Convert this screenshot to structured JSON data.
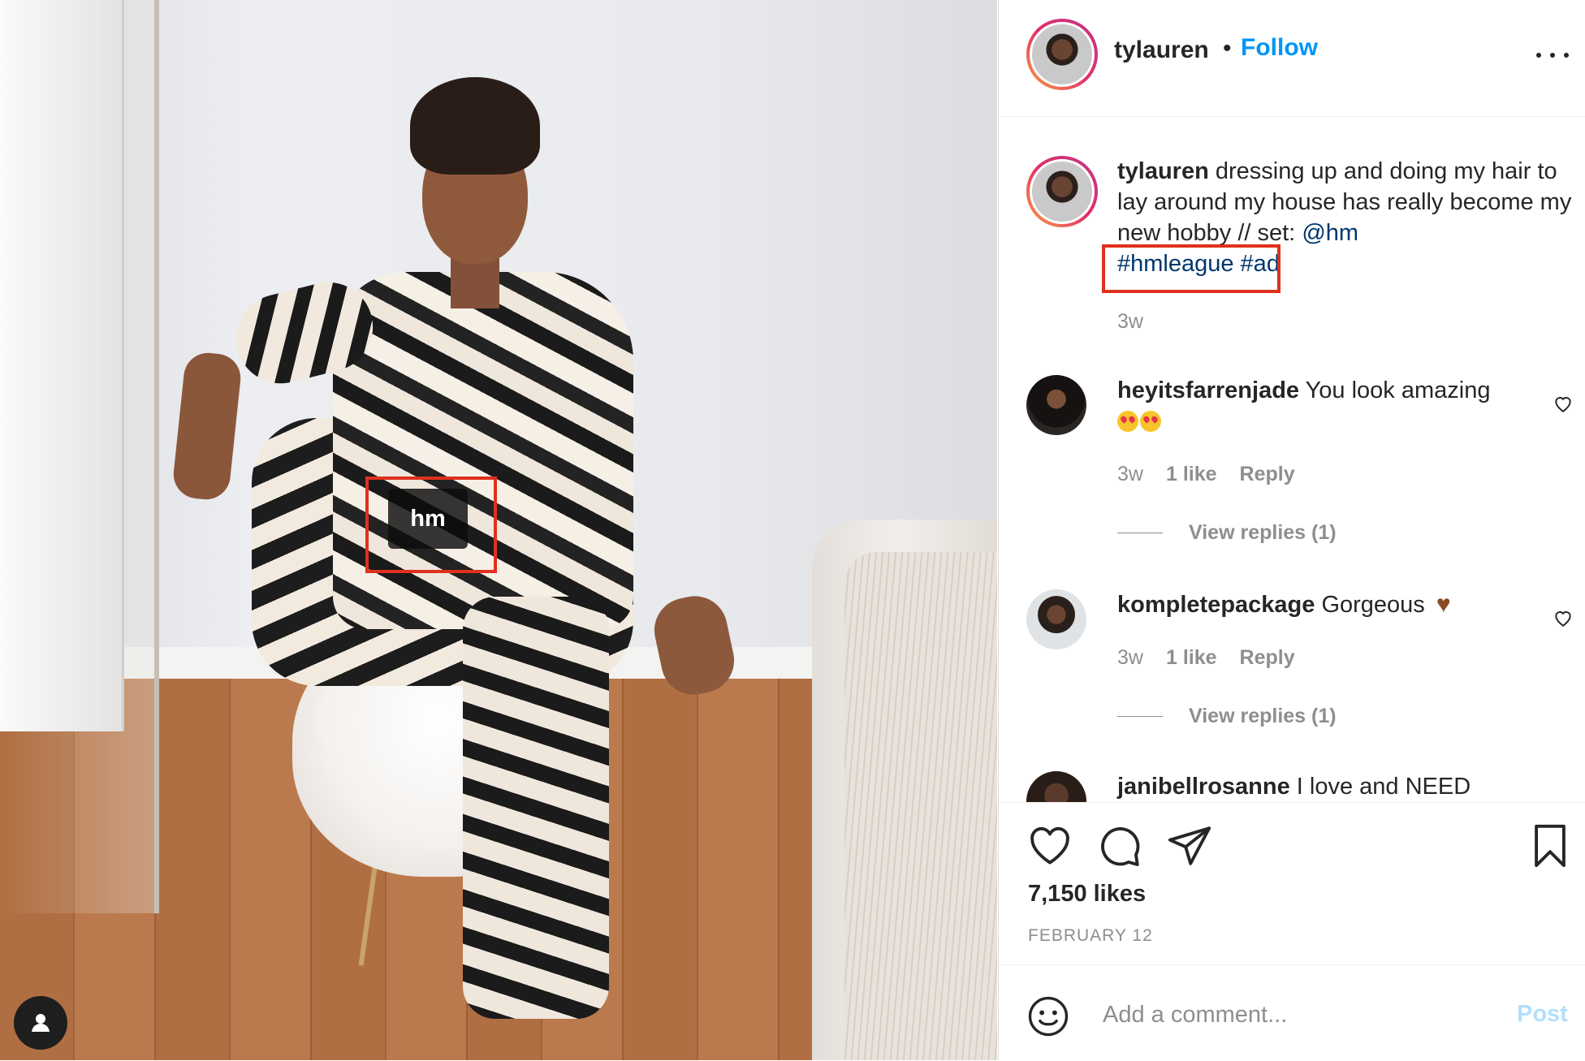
{
  "post": {
    "photo_tag": "hm"
  },
  "header": {
    "username": "tylauren",
    "separator": "•",
    "follow_label": "Follow"
  },
  "caption": {
    "username": "tylauren",
    "text": " dressing up and doing my hair to lay around my house has really become my new hobby // set: ",
    "mention": "@hm",
    "hashtags": "#hmleague #ad",
    "timestamp": "3w"
  },
  "comments": [
    {
      "username": "heyitsfarrenjade",
      "text": " You look amazing ",
      "emoji": "heart-eyes-emoji x2",
      "time": "3w",
      "likes": "1 like",
      "reply_label": "Reply",
      "view_replies": "View replies (1)"
    },
    {
      "username": "kompletepackage",
      "text": " Gorgeous ",
      "emoji": "brown-heart-emoji",
      "time": "3w",
      "likes": "1 like",
      "reply_label": "Reply",
      "view_replies": "View replies (1)"
    },
    {
      "username": "janibellrosanne",
      "text": " I love and NEED"
    }
  ],
  "actions": {
    "likes_count": "7,150 likes",
    "date": "FEBRUARY 12"
  },
  "comment_box": {
    "placeholder": "Add a comment...",
    "post_label": "Post"
  },
  "colors": {
    "accent": "#0095f6",
    "link": "#00376b",
    "muted": "#8e8e8e",
    "post_disabled": "#b2dffc",
    "highlight_box": "#e0301e"
  },
  "icons": [
    "more-icon",
    "heart-icon",
    "comment-icon",
    "share-icon",
    "bookmark-icon",
    "emoji-icon",
    "user-tags-icon"
  ]
}
